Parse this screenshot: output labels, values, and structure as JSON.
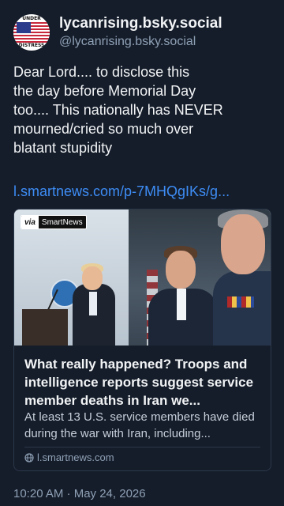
{
  "author": {
    "display_name": "lycanrising.bsky.social",
    "handle": "@lycanrising.bsky.social",
    "avatar_text_top": "UNDER",
    "avatar_text_bottom": "DISTRESS"
  },
  "post": {
    "text": "Dear Lord.... to disclose this\nthe day before Memorial Day\ntoo....  This nationally has NEVER\nmourned/cried so much over\nblatant stupidity",
    "link": "l.smartnews.com/p-7MHQgIKs/g..."
  },
  "card": {
    "via_label": "via",
    "via_brand": "SmartNews",
    "title": "What really happened? Troops and intelligence reports suggest service member deaths in Iran we...",
    "description": "At least 13 U.S. service members have died during the war with Iran, including...",
    "domain": "l.smartnews.com"
  },
  "timestamp": "10:20 AM · May 24, 2026",
  "icons": {
    "domain": "globe-icon"
  },
  "colors": {
    "background": "#151d2a",
    "link": "#3d8cf5",
    "muted": "#8fa0b5"
  }
}
